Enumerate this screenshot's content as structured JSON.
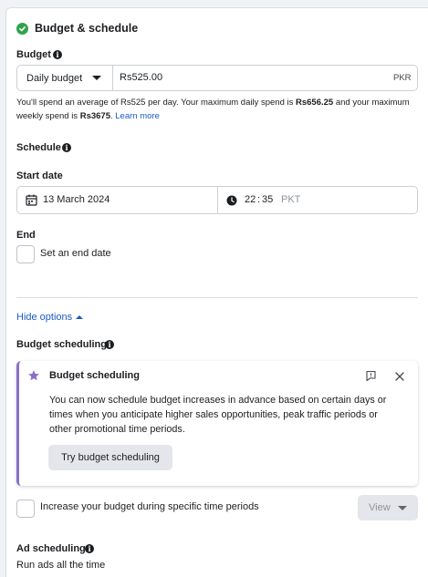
{
  "section": {
    "title": "Budget & schedule"
  },
  "budget": {
    "label": "Budget",
    "type_selected": "Daily budget",
    "amount_value": "Rs525.00",
    "currency": "PKR",
    "note_prefix": "You'll spend an average of Rs525 per day. Your maximum daily spend is ",
    "note_max_daily": "Rs656.25",
    "note_middle": " and your maximum",
    "note_line2_prefix": "weekly spend is ",
    "note_max_weekly": "Rs3675",
    "note_line2_suffix": ".",
    "learn_more": "Learn more"
  },
  "schedule": {
    "label": "Schedule",
    "start_date_label": "Start date",
    "start_date_value": "13 March 2024",
    "time_hour": "22",
    "time_sep": ":",
    "time_minute": "35",
    "timezone": "PKT",
    "end_label": "End",
    "end_checkbox_label": "Set an end date"
  },
  "hide_options": "Hide options",
  "budget_scheduling": {
    "label": "Budget scheduling",
    "card_title": "Budget scheduling",
    "card_text_1": "You can now schedule budget increases in advance based on certain days or",
    "card_text_2": "times when you anticipate higher sales opportunities, peak traffic periods or",
    "card_text_3": "other promotional time periods.",
    "try_button": "Try budget scheduling",
    "increase_checkbox_label": "Increase your budget during specific time periods",
    "view_button": "View"
  },
  "ad_scheduling": {
    "label": "Ad scheduling",
    "value": "Run ads all the time"
  },
  "colors": {
    "accent_purple": "#8a70c9",
    "link_blue": "#1a5bc4",
    "success_green": "#31a24c"
  }
}
